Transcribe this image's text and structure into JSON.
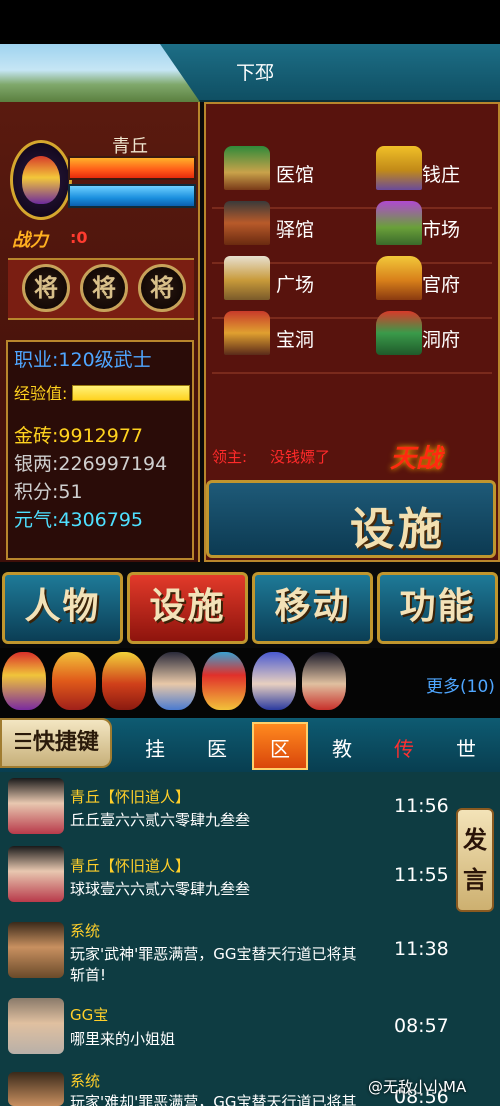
{
  "header": {
    "location": "下邳"
  },
  "character": {
    "name": "青丘",
    "power_label": "战力",
    "power_value": ":0",
    "general_slots": [
      "将",
      "将",
      "将"
    ]
  },
  "stats": {
    "job": "职业:120级武士",
    "exp_label": "经验值:",
    "gold_brick": "金砖:9912977",
    "silver": "银两:226997194",
    "points": "积分:51",
    "vitality": "元气:4306795"
  },
  "facilities": [
    {
      "label": "医馆",
      "icon": "clinic-icon"
    },
    {
      "label": "钱庄",
      "icon": "bank-icon"
    },
    {
      "label": "驿馆",
      "icon": "inn-icon"
    },
    {
      "label": "市场",
      "icon": "market-icon"
    },
    {
      "label": "广场",
      "icon": "square-icon"
    },
    {
      "label": "官府",
      "icon": "government-icon"
    },
    {
      "label": "宝洞",
      "icon": "treasure-cave-icon"
    },
    {
      "label": "洞府",
      "icon": "cave-residence-icon"
    }
  ],
  "owner": {
    "label": "领主:",
    "value": "没钱嫖了"
  },
  "battle_logo": "天战",
  "facility_button": "设施",
  "menu": [
    "人物",
    "设施",
    "移动",
    "功能"
  ],
  "generals_more": "更多(10)",
  "quick": {
    "label": "☰快捷键",
    "tabs": [
      "挂",
      "医",
      "区",
      "教",
      "传",
      "世"
    ]
  },
  "chat": [
    {
      "name": "青丘【怀旧道人】",
      "msg": "丘丘壹六六贰六零肆九叁叁",
      "time": "11:56"
    },
    {
      "name": "青丘【怀旧道人】",
      "msg": "球球壹六六贰六零肆九叁叁",
      "time": "11:55"
    },
    {
      "name": "系统",
      "msg": "玩家'武神'罪恶满营，GG宝替天行道已将其斩首!",
      "time": "11:38"
    },
    {
      "name": "GG宝",
      "msg": "哪里来的小姐姐",
      "time": "08:57"
    },
    {
      "name": "系统",
      "msg": "玩家'难却'罪恶满营，GG宝替天行道已将其斩",
      "time": "08:56"
    }
  ],
  "speak_button": "发言",
  "watermark": "@无敌小小MA",
  "colors": {
    "accent_gold": "#b8862c",
    "panel_red": "#58130d",
    "chat_bg": "#0e3c42",
    "name_yellow": "#ffcf2a"
  }
}
